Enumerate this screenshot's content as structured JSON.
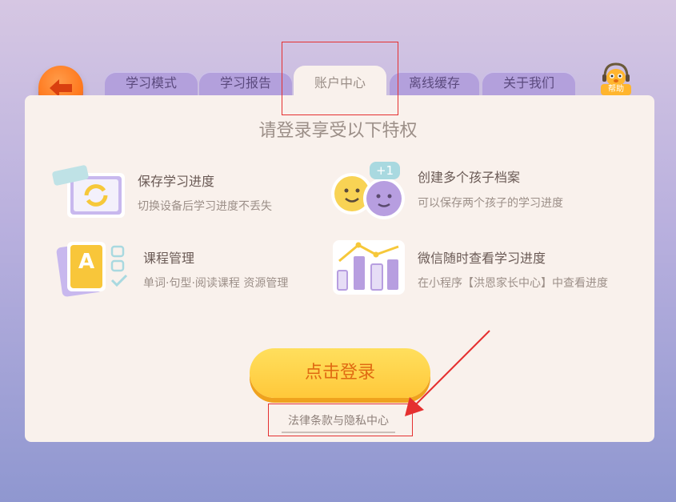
{
  "tabs": [
    {
      "label": "学习模式",
      "active": false
    },
    {
      "label": "学习报告",
      "active": false
    },
    {
      "label": "账户中心",
      "active": true
    },
    {
      "label": "离线缓存",
      "active": false
    },
    {
      "label": "关于我们",
      "active": false
    }
  ],
  "help": {
    "label": "帮助"
  },
  "headline": "请登录享受以下特权",
  "features": [
    {
      "title": "保存学习进度",
      "desc": "切换设备后学习进度不丢失",
      "icon": "sync-tablet-icon"
    },
    {
      "title": "创建多个孩子档案",
      "desc": "可以保存两个孩子的学习进度",
      "icon": "two-kids-faces-icon",
      "badge": "+1"
    },
    {
      "title": "课程管理",
      "desc": "单词·句型·阅读课程 资源管理",
      "icon": "course-cards-icon",
      "card_letter": "A"
    },
    {
      "title": "微信随时查看学习进度",
      "desc": "在小程序【洪恩家长中心】中查看进度",
      "icon": "progress-chart-icon"
    }
  ],
  "login_button": "点击登录",
  "legal_link": "法律条款与隐私中心",
  "colors": {
    "accent_orange": "#ff7a1f",
    "login_yellow": "#ffc83a",
    "tab_purple": "#b3a0dc",
    "panel": "#f9f1ec",
    "annotation_red": "#e53030"
  }
}
